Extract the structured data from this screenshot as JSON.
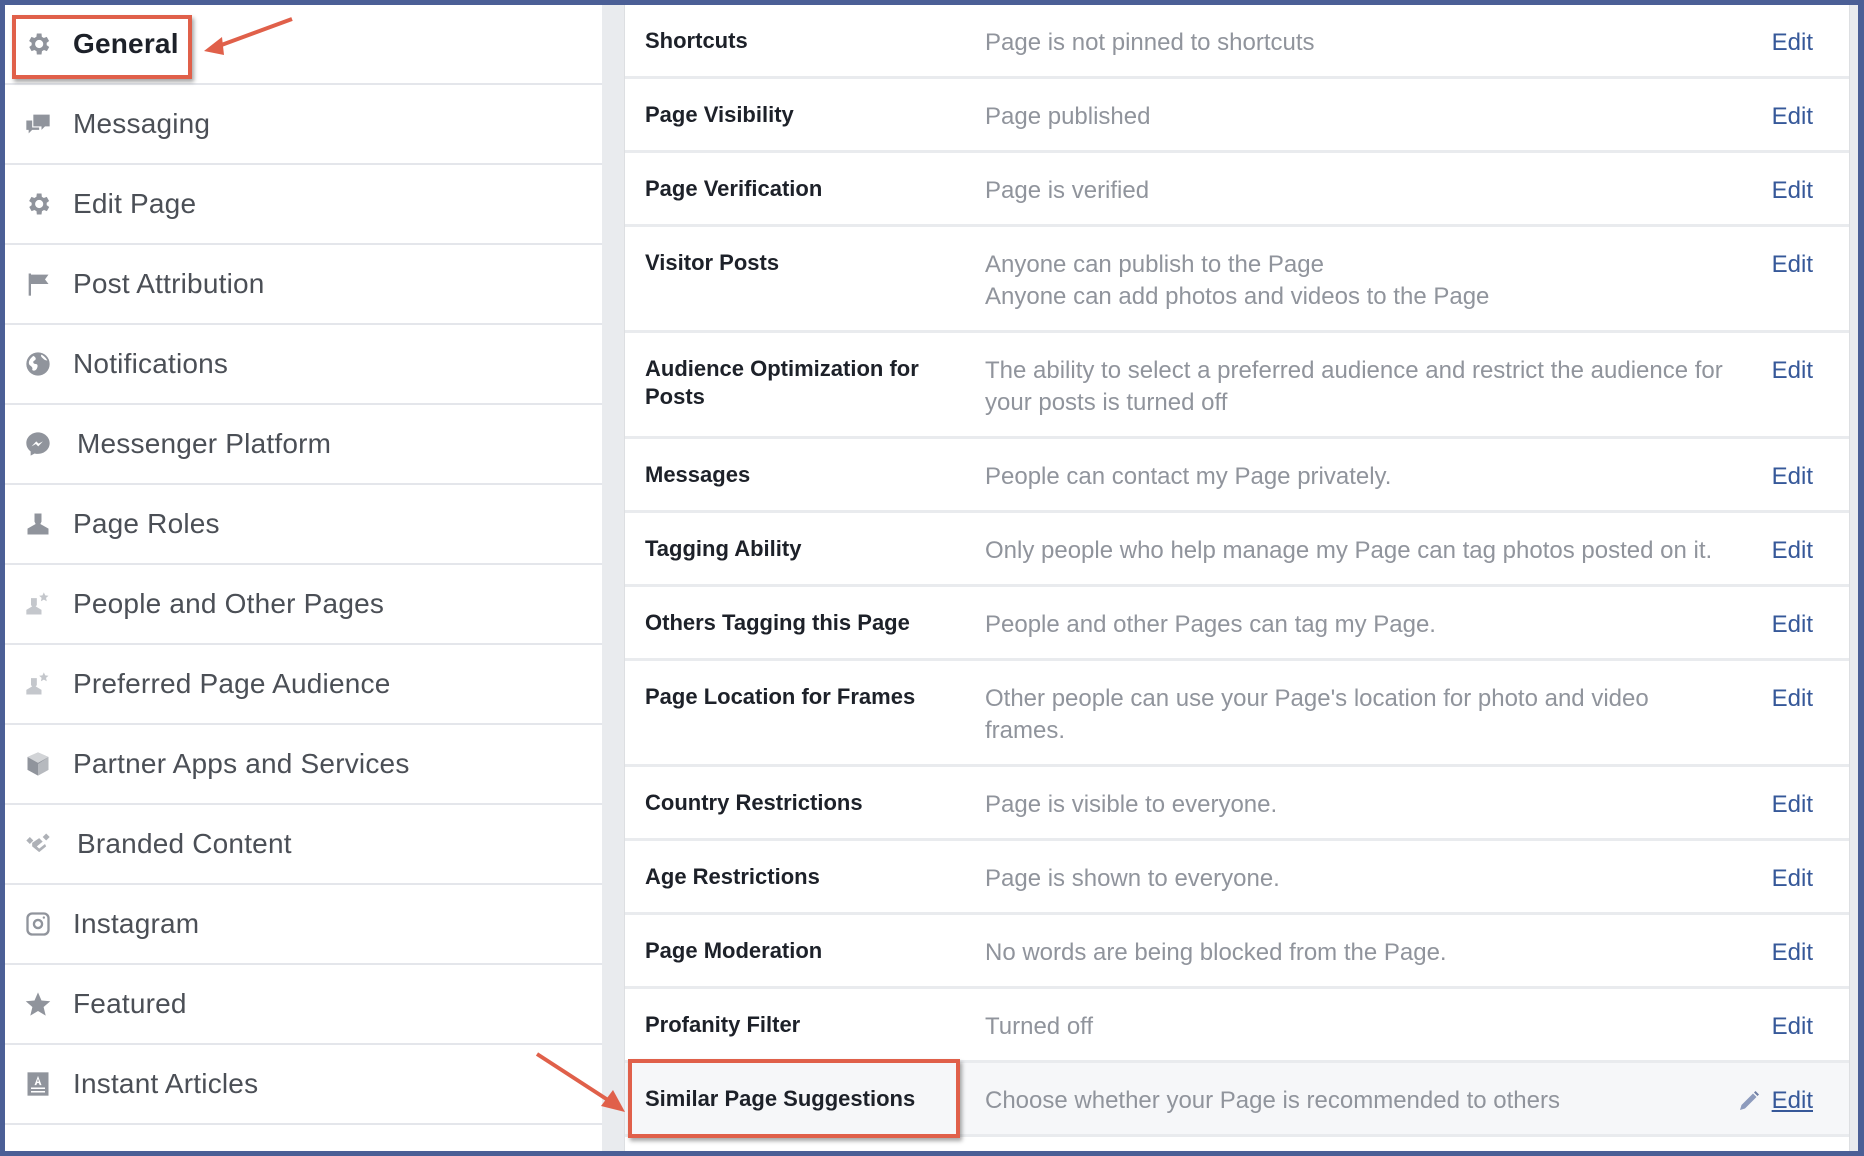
{
  "sidebar": {
    "items": [
      {
        "label": "General",
        "icon": "gear-icon",
        "active": true
      },
      {
        "label": "Messaging",
        "icon": "chat-bubbles-icon"
      },
      {
        "label": "Edit Page",
        "icon": "gear-icon"
      },
      {
        "label": "Post Attribution",
        "icon": "flag-icon"
      },
      {
        "label": "Notifications",
        "icon": "globe-icon"
      },
      {
        "label": "Messenger Platform",
        "icon": "messenger-icon"
      },
      {
        "label": "Page Roles",
        "icon": "person-icon"
      },
      {
        "label": "People and Other Pages",
        "icon": "person-star-icon"
      },
      {
        "label": "Preferred Page Audience",
        "icon": "person-star-icon"
      },
      {
        "label": "Partner Apps and Services",
        "icon": "cube-icon"
      },
      {
        "label": "Branded Content",
        "icon": "handshake-icon"
      },
      {
        "label": "Instagram",
        "icon": "instagram-icon"
      },
      {
        "label": "Featured",
        "icon": "star-icon"
      },
      {
        "label": "Instant Articles",
        "icon": "article-icon"
      }
    ]
  },
  "settings": {
    "edit_label": "Edit",
    "rows": [
      {
        "label": "Shortcuts",
        "value": "Page is not pinned to shortcuts"
      },
      {
        "label": "Page Visibility",
        "value": "Page published"
      },
      {
        "label": "Page Verification",
        "value": "Page is verified"
      },
      {
        "label": "Visitor Posts",
        "value": "Anyone can publish to the Page",
        "value2": "Anyone can add photos and videos to the Page"
      },
      {
        "label": "Audience Optimization for Posts",
        "value": "The ability to select a preferred audience and restrict the audience for your posts is turned off"
      },
      {
        "label": "Messages",
        "value": "People can contact my Page privately."
      },
      {
        "label": "Tagging Ability",
        "value": "Only people who help manage my Page can tag photos posted on it."
      },
      {
        "label": "Others Tagging this Page",
        "value": "People and other Pages can tag my Page."
      },
      {
        "label": "Page Location for Frames",
        "value": "Other people can use your Page's location for photo and video frames."
      },
      {
        "label": "Country Restrictions",
        "value": "Page is visible to everyone."
      },
      {
        "label": "Age Restrictions",
        "value": "Page is shown to everyone."
      },
      {
        "label": "Page Moderation",
        "value": "No words are being blocked from the Page."
      },
      {
        "label": "Profanity Filter",
        "value": "Turned off"
      },
      {
        "label": "Similar Page Suggestions",
        "value": "Choose whether your Page is recommended to others",
        "highlighted": true
      }
    ]
  },
  "colors": {
    "frame_border": "#4b5f96",
    "link": "#365899",
    "annotation": "#e0604a"
  }
}
